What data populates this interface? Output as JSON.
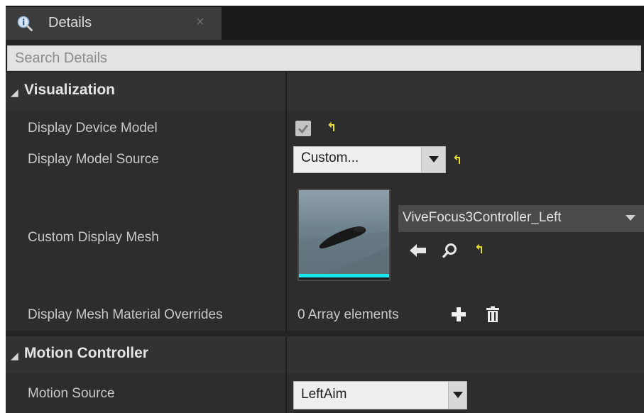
{
  "tab": {
    "title": "Details",
    "icon": "details-info-icon",
    "close_glyph": "×"
  },
  "search": {
    "placeholder": "Search Details",
    "value": ""
  },
  "categories": [
    {
      "label": "Visualization",
      "expanded": true
    },
    {
      "label": "Motion Controller",
      "expanded": true
    }
  ],
  "visualization": {
    "display_device_model": {
      "label": "Display Device Model",
      "checked": true,
      "reset_glyph": "↰"
    },
    "display_model_source": {
      "label": "Display Model Source",
      "value": "Custom...",
      "reset_glyph": "↰"
    },
    "custom_display_mesh": {
      "label": "Custom Display Mesh",
      "asset": "ViveFocus3Controller_Left",
      "reset_glyph": "↰",
      "icons": [
        "use-selected-arrow-icon",
        "browse-magnifier-icon"
      ]
    },
    "material_overrides": {
      "label": "Display Mesh Material Overrides",
      "value": "0 Array elements",
      "icons": [
        "add-plus-icon",
        "trash-icon"
      ]
    }
  },
  "motion_controller": {
    "motion_source": {
      "label": "Motion Source",
      "value": "LeftAim"
    }
  },
  "colors": {
    "panel_bg": "#242424",
    "row_bg": "#2d2d2d",
    "category_bg": "#323232",
    "reset_yellow": "#e8dc32",
    "thumbnail_accent": "#19e6f2"
  }
}
